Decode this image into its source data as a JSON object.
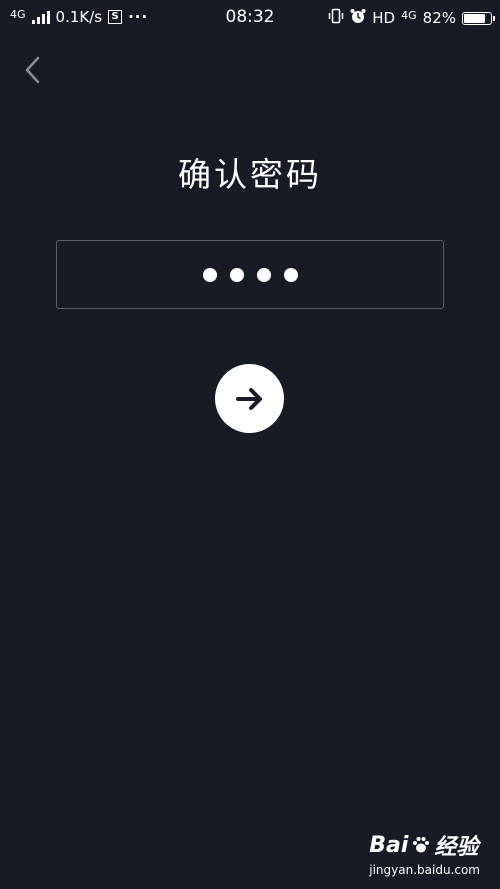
{
  "status_bar": {
    "network_tag": "4G",
    "speed": "0.1K/s",
    "s_icon_label": "S",
    "more": "···",
    "time": "08:32",
    "hd_label": "HD",
    "network_tag_right": "4G",
    "battery_percent": "82%",
    "battery_level": 0.82
  },
  "page": {
    "title": "确认密码",
    "password_length": 4
  },
  "watermark": {
    "logo_text": "Bai",
    "logo_suffix": "经验",
    "url": "jingyan.baidu.com"
  },
  "colors": {
    "background": "#181b26",
    "field_border": "#5c5f6a",
    "foreground": "#ffffff"
  }
}
